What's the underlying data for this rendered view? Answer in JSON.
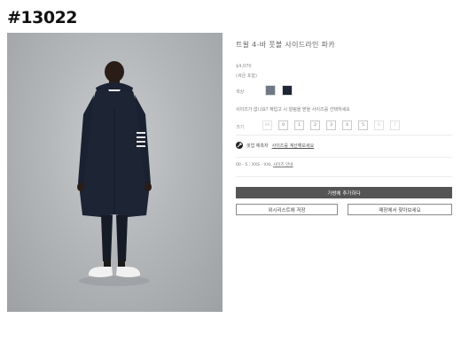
{
  "item_code": "#13022",
  "product": {
    "title": "트윌 4-바 풋볼 사이드라인 파카",
    "price": "$4,070",
    "tax_note": "(세금 포함)"
  },
  "color": {
    "label": "색상",
    "swatches": [
      {
        "name": "grey",
        "color": "#6f7883"
      },
      {
        "name": "navy",
        "color": "#1e2535"
      }
    ]
  },
  "size": {
    "hint": "사이즈가 없나요? 재입고 시 알림을 받을 사이즈를 선택하세요",
    "label": "크기",
    "options": [
      {
        "label": "00",
        "available": false
      },
      {
        "label": "0",
        "available": true
      },
      {
        "label": "1",
        "available": true
      },
      {
        "label": "2",
        "available": true
      },
      {
        "label": "3",
        "available": true
      },
      {
        "label": "4",
        "available": true
      },
      {
        "label": "5",
        "available": true
      },
      {
        "label": "6",
        "available": false
      },
      {
        "label": "7",
        "available": false
      }
    ]
  },
  "fit": {
    "prefix": "핏업 예측자",
    "link": "사이즈를 계산해보세요"
  },
  "size_range": {
    "text": "00 - 5 : XXS - XXL",
    "link": "사이즈 안내"
  },
  "actions": {
    "add_to_bag": "가방에 추가하다",
    "wishlist": "위시리스트에 저장",
    "find_in_store": "매장에서 찾아보세요"
  }
}
